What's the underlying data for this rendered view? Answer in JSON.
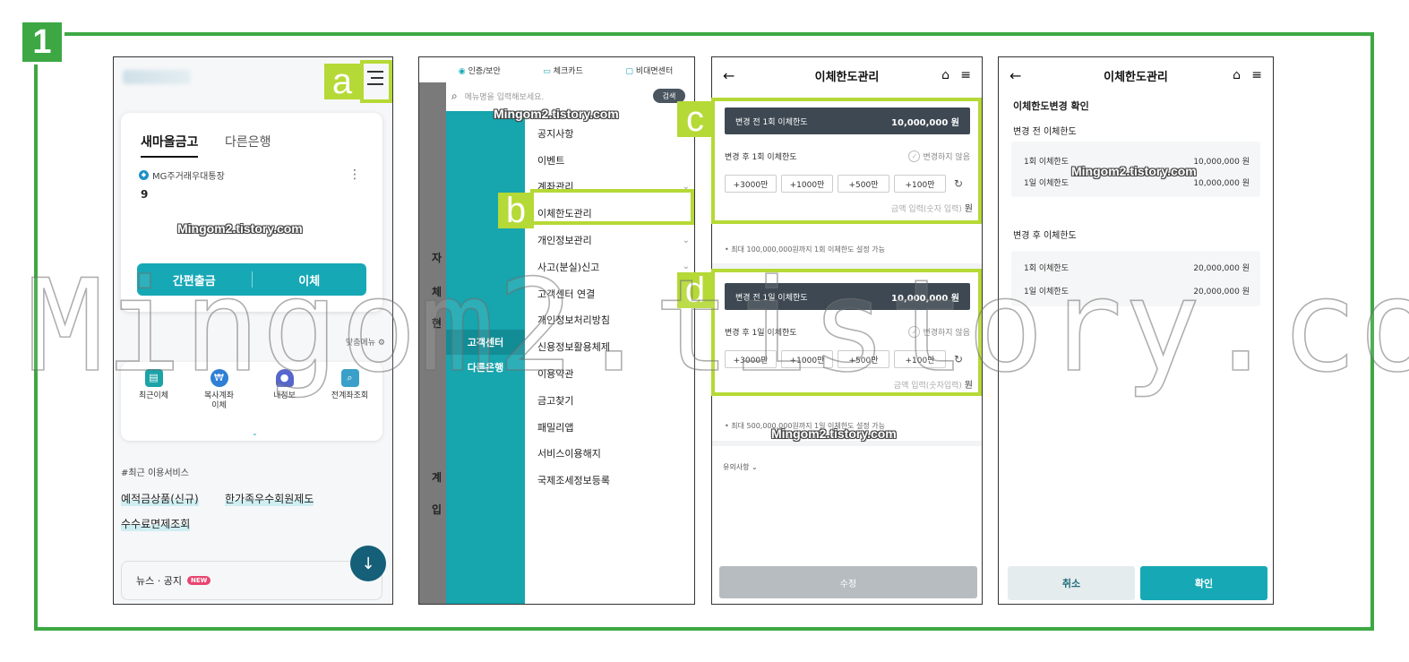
{
  "step_number": "1",
  "callouts": {
    "a": "a",
    "b": "b",
    "c": "c",
    "d": "d"
  },
  "watermark": {
    "big": "Mingom2.tistory.com",
    "small": "Mingom2.tistory.com"
  },
  "panel1": {
    "tabs": [
      "새마을금고",
      "다른은행"
    ],
    "account_name": "MG주거래우대통장",
    "account_number": "9",
    "quick_withdraw": "간편출금",
    "transfer": "이체",
    "custom_menu": "맞춤메뉴",
    "quick_items": [
      {
        "label": "최근이체",
        "icon": "recent-transfer-icon",
        "color": "#1ba3a8"
      },
      {
        "label": "복사계좌\n이체",
        "icon": "copy-account-icon",
        "color": "#2f7fd6"
      },
      {
        "label": "내정보",
        "icon": "user-icon",
        "color": "#5566cc"
      },
      {
        "label": "전계좌조회",
        "icon": "search-icon",
        "color": "#3aa0c9"
      }
    ],
    "recent_title": "#최근 이용서비스",
    "recent_links": [
      "예적금상품(신규)",
      "한가족우수회원제도",
      "수수료면제조회"
    ],
    "news": "뉴스 · 공지",
    "news_badge": "NEW"
  },
  "panel2": {
    "top_links": [
      {
        "icon": "shield-icon",
        "label": "인증/보안"
      },
      {
        "icon": "card-icon",
        "label": "체크카드"
      },
      {
        "icon": "chat-icon",
        "label": "비대면센터"
      }
    ],
    "search_placeholder": "메뉴명을 입력해보세요.",
    "search_button": "검색",
    "side_items": [
      "고객센터",
      "다른은행"
    ],
    "menu_items": [
      {
        "label": "공지사항",
        "chevron": false
      },
      {
        "label": "이벤트",
        "chevron": false
      },
      {
        "label": "계좌관리",
        "chevron": true
      },
      {
        "label": "이체한도관리",
        "chevron": false
      },
      {
        "label": "개인정보관리",
        "chevron": true
      },
      {
        "label": "사고(분실)신고",
        "chevron": true
      },
      {
        "label": "고객센터 연결",
        "chevron": false
      },
      {
        "label": "개인정보처리방침",
        "chevron": false
      },
      {
        "label": "신용정보활용체제",
        "chevron": false
      },
      {
        "label": "이용약관",
        "chevron": false
      },
      {
        "label": "금고찾기",
        "chevron": false
      },
      {
        "label": "패밀리앱",
        "chevron": false
      },
      {
        "label": "서비스이용해지",
        "chevron": false
      },
      {
        "label": "국제조세정보등록",
        "chevron": false
      }
    ],
    "bg_texts": [
      "자",
      "체",
      "현",
      "계",
      "입"
    ]
  },
  "panel3": {
    "title": "이체한도관리",
    "once": {
      "before_label": "변경 전 1회 이체한도",
      "before_value": "10,000,000 원",
      "after_label": "변경 후 1회 이체한도",
      "no_change": "변경하지 않음",
      "amounts": [
        "+3000만",
        "+1000만",
        "+500만",
        "+100만"
      ],
      "input_placeholder": "금액 입력(숫자 입력)",
      "unit": "원",
      "note": "• 최대 100,000,000원까지 1회 이체한도 설정 가능"
    },
    "daily": {
      "before_label": "변경 전 1일 이체한도",
      "before_value": "10,000,000 원",
      "after_label": "변경 후 1일 이체한도",
      "no_change": "변경하지 않음",
      "amounts": [
        "+3000만",
        "+1000만",
        "+500만",
        "+100만"
      ],
      "input_placeholder": "금액 입력(숫자입력)",
      "unit": "원",
      "note": "• 최대 500,000,000원까지 1일 이체한도 설정 가능"
    },
    "caution": "유의사항",
    "submit": "수정"
  },
  "panel4": {
    "title": "이체한도관리",
    "confirm_title": "이체한도변경 확인",
    "before_title": "변경 전 이체한도",
    "before_rows": [
      {
        "label": "1회 이체한도",
        "value": "10,000,000 원"
      },
      {
        "label": "1일 이체한도",
        "value": "10,000,000 원"
      }
    ],
    "after_title": "변경 후 이체한도",
    "after_rows": [
      {
        "label": "1회 이체한도",
        "value": "20,000,000 원"
      },
      {
        "label": "1일 이체한도",
        "value": "20,000,000 원"
      }
    ],
    "cancel": "취소",
    "confirm": "확인"
  },
  "colors": {
    "frame_green": "#3da843",
    "callout_lime": "#b5d936",
    "teal": "#17a8b6",
    "dark_bar": "#3d4852"
  }
}
